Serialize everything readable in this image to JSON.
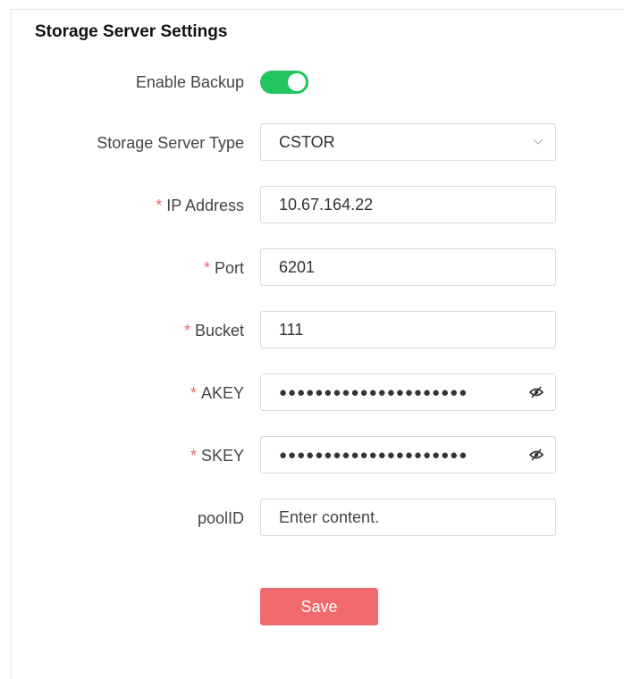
{
  "section_title": "Storage Server Settings",
  "form": {
    "enable_backup": {
      "label": "Enable Backup",
      "enabled": true
    },
    "server_type": {
      "label": "Storage Server Type",
      "value": "CSTOR"
    },
    "ip_address": {
      "required_mark": "*",
      "label": "IP Address",
      "value": "10.67.164.22"
    },
    "port": {
      "required_mark": "*",
      "label": "Port",
      "value": "6201"
    },
    "bucket": {
      "required_mark": "*",
      "label": "Bucket",
      "value": "111"
    },
    "akey": {
      "required_mark": "*",
      "label": "AKEY",
      "value": "●●●●●●●●●●●●●●●●●●●●●"
    },
    "skey": {
      "required_mark": "*",
      "label": "SKEY",
      "value": "●●●●●●●●●●●●●●●●●●●●●"
    },
    "pool_id": {
      "label": "poolID",
      "placeholder": "Enter content."
    }
  },
  "save_label": "Save",
  "colors": {
    "accent": "#f0696c",
    "toggle_on": "#22c55e",
    "required": "#f0666a"
  },
  "icons": {
    "server_type_dropdown": "chevron-down-icon",
    "akey_visibility": "eye-slash-icon",
    "skey_visibility": "eye-slash-icon"
  }
}
